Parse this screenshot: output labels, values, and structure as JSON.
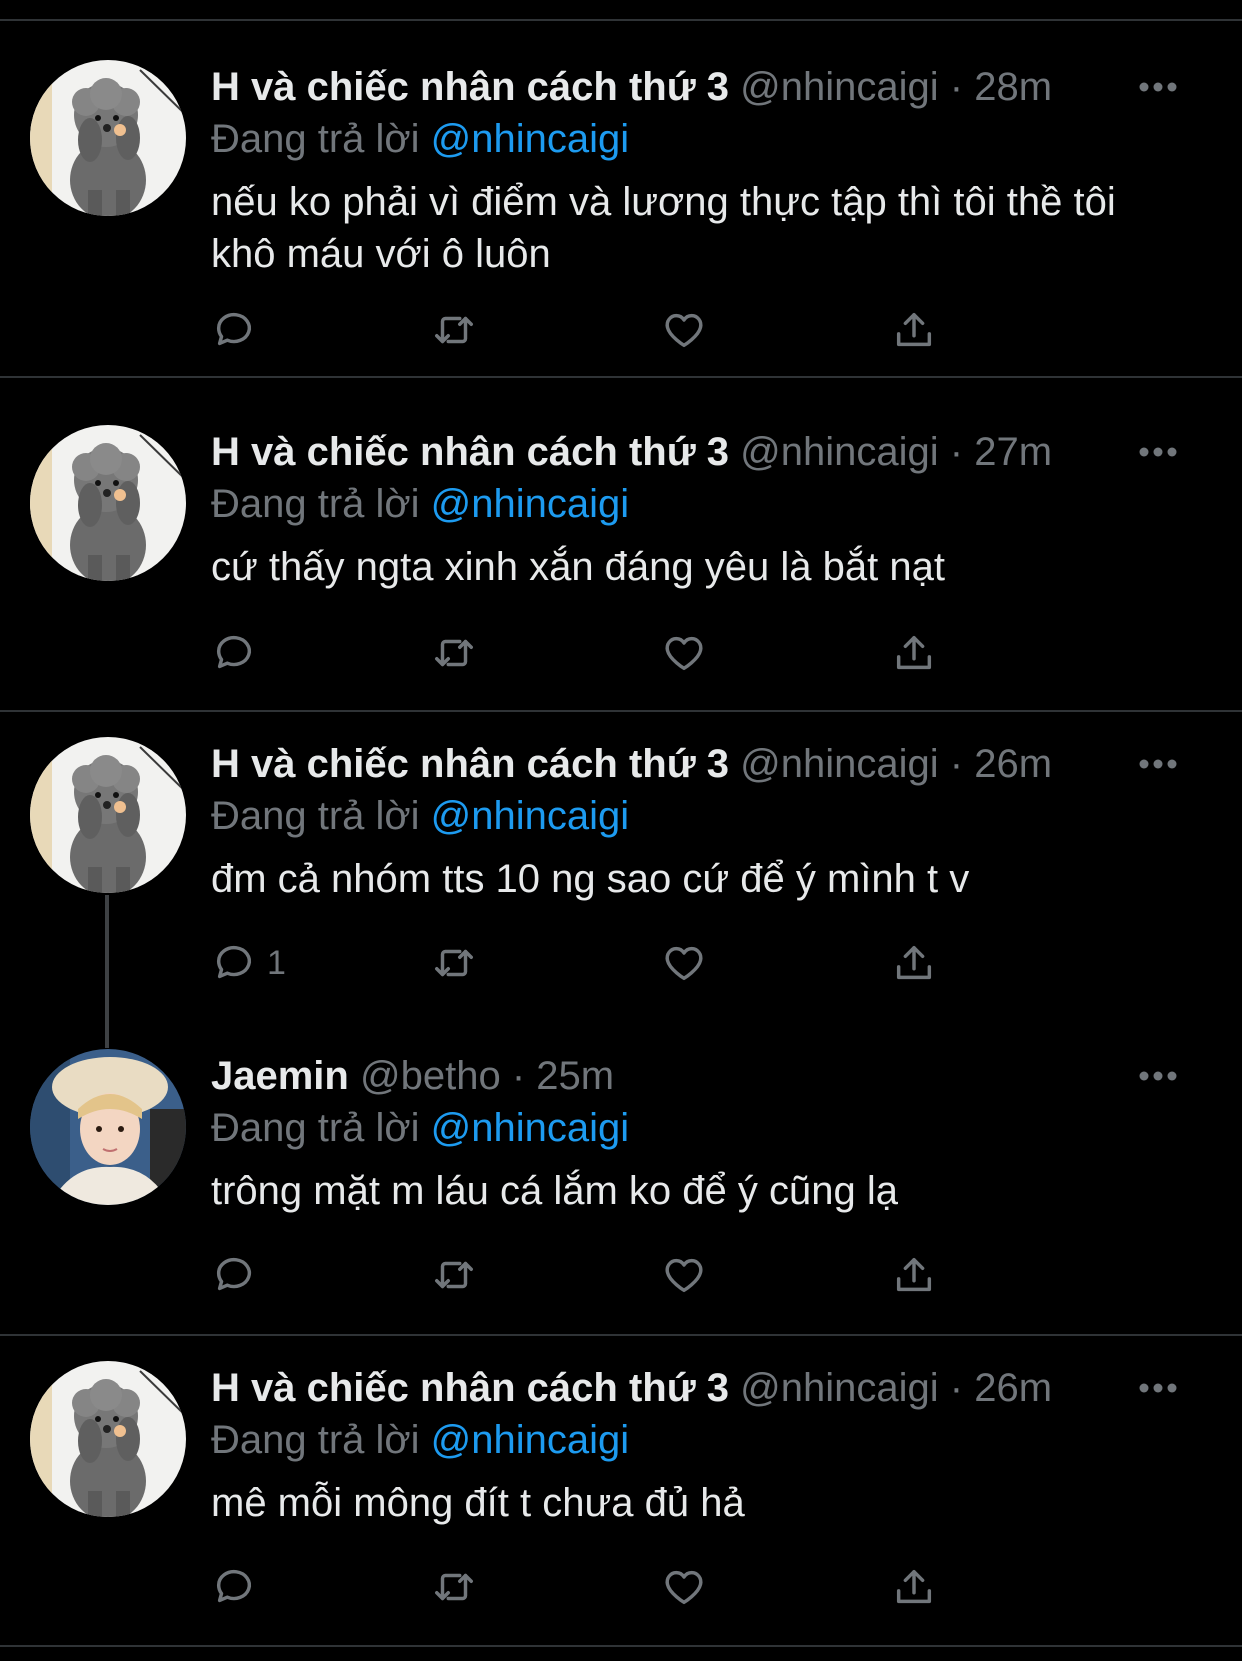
{
  "colors": {
    "background": "#000000",
    "text": "#e7e9ea",
    "secondary": "#71767b",
    "accent": "#1d9bf0",
    "divider": "#2f3336"
  },
  "tweets": [
    {
      "name": "H và chiếc nhân cách thứ 3",
      "handle": "@nhincaigi",
      "separator": "·",
      "time": "28m",
      "replying_label": "Đang trả lời",
      "replying_to": "@nhincaigi",
      "text": "nếu ko phải vì điểm và lương thực tập thì tôi thề tôi khô máu với ô luôn",
      "reply_count": "",
      "avatar": "poodle-avatar"
    },
    {
      "name": "H và chiếc nhân cách thứ 3",
      "handle": "@nhincaigi",
      "separator": "·",
      "time": "27m",
      "replying_label": "Đang trả lời",
      "replying_to": "@nhincaigi",
      "text": "cứ thấy ngta xinh xắn đáng yêu là bắt nạt",
      "reply_count": "",
      "avatar": "poodle-avatar"
    },
    {
      "name": "H và chiếc nhân cách thứ 3",
      "handle": "@nhincaigi",
      "separator": "·",
      "time": "26m",
      "replying_label": "Đang trả lời",
      "replying_to": "@nhincaigi",
      "text": "đm cả nhóm tts 10 ng sao cứ để ý mình t v",
      "reply_count": "1",
      "avatar": "poodle-avatar"
    },
    {
      "name": "Jaemin",
      "handle": "@betho",
      "separator": "·",
      "time": "25m",
      "replying_label": "Đang trả lời",
      "replying_to": "@nhincaigi",
      "text": "trông mặt m láu cá lắm ko để ý cũng lạ",
      "reply_count": "",
      "avatar": "person-avatar"
    },
    {
      "name": "H và chiếc nhân cách thứ 3",
      "handle": "@nhincaigi",
      "separator": "·",
      "time": "26m",
      "replying_label": "Đang trả lời",
      "replying_to": "@nhincaigi",
      "text": "mê mỗi mông đít t chưa đủ hả",
      "reply_count": "",
      "avatar": "poodle-avatar"
    }
  ],
  "icons": {
    "reply": "reply-icon",
    "retweet": "retweet-icon",
    "like": "heart-icon",
    "share": "share-icon",
    "more": "more-icon"
  }
}
